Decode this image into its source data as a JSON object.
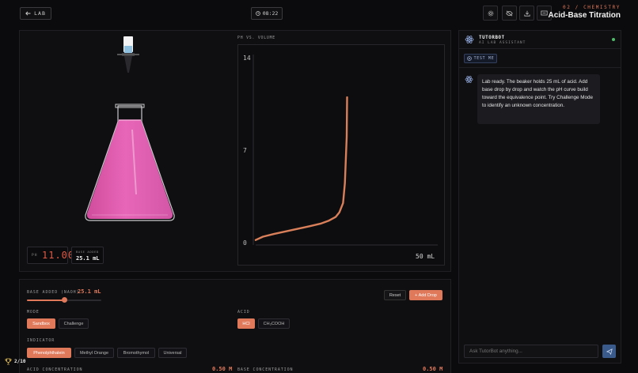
{
  "header": {
    "back_label": "LAB",
    "timer": "08:22",
    "kicker": "02 / CHEMISTRY",
    "title": "Acid-Base Titration",
    "tools": [
      "settings-icon",
      "eye-off-icon",
      "download-icon",
      "screen-icon"
    ]
  },
  "stage": {
    "ph_label": "PH",
    "ph_value": "11.00",
    "base_added_label": "BASE ADDED",
    "base_added_value": "25.1 mL",
    "solution_color": "#e866b8"
  },
  "chart_data": {
    "type": "line",
    "title": "PH VS. VOLUME",
    "xlabel": "",
    "ylabel": "",
    "ylim": [
      0,
      14
    ],
    "xlim": [
      0,
      50
    ],
    "y_ticks": [
      "14",
      "7",
      "0"
    ],
    "x_end_label": "50 mL",
    "series": [
      {
        "color": "#d9805a",
        "x": [
          0,
          2,
          5,
          10,
          15,
          18,
          20,
          22,
          23,
          24,
          24.5,
          25,
          25.1
        ],
        "y": [
          0.2,
          0.45,
          0.65,
          0.95,
          1.25,
          1.45,
          1.65,
          1.95,
          2.3,
          3.0,
          4.5,
          8.0,
          11.0
        ]
      }
    ]
  },
  "controls": {
    "base_added_label": "BASE ADDED (NAOH)",
    "base_added_value": "25.1 mL",
    "slider_fraction": 0.502,
    "reset_label": "Reset",
    "add_drop_label": "+ Add Drop",
    "mode_label": "MODE",
    "modes": [
      {
        "label": "Sandbox",
        "active": true
      },
      {
        "label": "Challenge",
        "active": false
      }
    ],
    "acid_label": "ACID",
    "acids": [
      {
        "label": "HCl",
        "active": true
      },
      {
        "label": "CH₃COOH",
        "active": false
      }
    ],
    "indicator_label": "INDICATOR",
    "indicators": [
      {
        "label": "Phenolphthalein",
        "active": true
      },
      {
        "label": "Methyl Orange",
        "active": false
      },
      {
        "label": "Bromothymol",
        "active": false
      },
      {
        "label": "Universal",
        "active": false
      }
    ],
    "acid_conc_label": "ACID CONCENTRATION",
    "acid_conc_value": "0.50 M",
    "base_conc_label": "BASE CONCENTRATION",
    "base_conc_value": "0.50 M"
  },
  "tutor": {
    "name": "TUTORBOT",
    "subtitle": "AI LAB ASSISTANT",
    "test_me_label": "TEST ME",
    "message": "Lab ready. The beaker holds 25 mL of acid. Add base drop by drop and watch the pH curve build toward the equivalence point. Try Challenge Mode to identify an unknown concentration.",
    "input_placeholder": "Ask TutorBot anything..."
  },
  "score": {
    "value": "2/10"
  },
  "colors": {
    "accent": "#e0785a",
    "online": "#4cbb6a",
    "send": "#3a5a8c"
  }
}
